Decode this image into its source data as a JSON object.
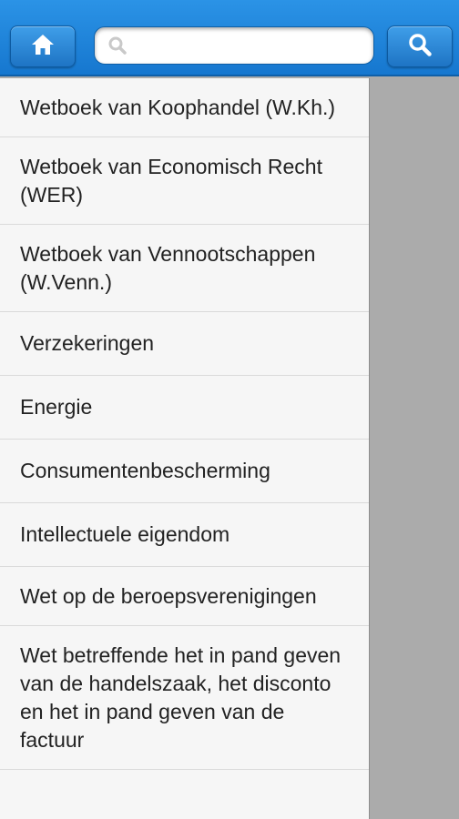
{
  "header": {
    "home_icon": "home-icon",
    "search_icon": "search-icon",
    "search_placeholder": "",
    "search_value": ""
  },
  "menu": {
    "items": [
      {
        "label": "Wetboek van Koophandel (W.Kh.)"
      },
      {
        "label": "Wetboek van Economisch Recht (WER)"
      },
      {
        "label": "Wetboek van Vennootschappen (W.Venn.)"
      },
      {
        "label": "Verzekeringen"
      },
      {
        "label": "Energie"
      },
      {
        "label": "Consumentenbescherming"
      },
      {
        "label": "Intellectuele eigendom"
      },
      {
        "label": "Wet op de beroepsverenigingen"
      },
      {
        "label": "Wet betreffende het in pand geven van de handelszaak, het disconto en het in pand geven van de factuur"
      }
    ]
  },
  "colors": {
    "header": "#1e82d8",
    "panel_bg": "#f6f6f6",
    "overlay": "#ababab"
  }
}
